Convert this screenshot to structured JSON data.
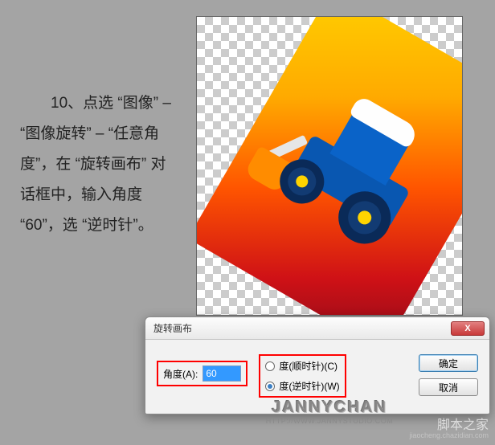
{
  "instruction": "10、点选 “图像” – “图像旋转” – “任意角度”，在 “旋转画布” 对话框中，输入角度 “60”，选 “逆时针”。",
  "dialog": {
    "title": "旋转画布",
    "close_label": "X",
    "angle_label": "角度(A):",
    "angle_value": "60",
    "cw_label": "度(顺时针)(C)",
    "ccw_label": "度(逆时针)(W)",
    "ok_label": "确定",
    "cancel_label": "取消",
    "selected": "ccw"
  },
  "watermark": {
    "brand": "JANNYCHAN",
    "url": "HTTP://WWW.JANNYSTUDIO.COM",
    "site": "脚本之家",
    "site_url": "jiaocheng.chazidian.com"
  }
}
